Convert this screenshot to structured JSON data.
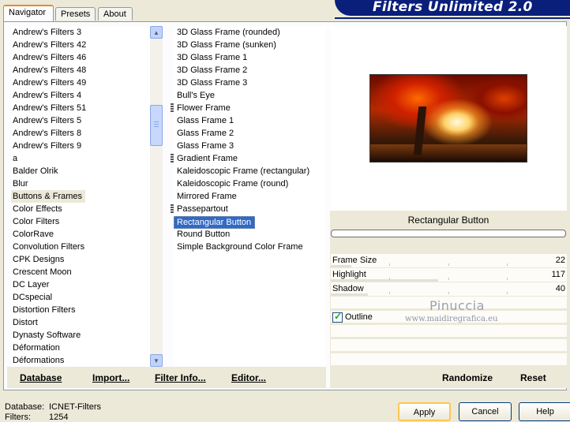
{
  "tabs": [
    "Navigator",
    "Presets",
    "About"
  ],
  "banner_title": "Filters Unlimited 2.0",
  "categories": [
    "Andrew's Filters 3",
    "Andrew's Filters 42",
    "Andrew's Filters 46",
    "Andrew's Filters 48",
    "Andrew's Filters 49",
    "Andrew's Filters 4",
    "Andrew's Filters 51",
    "Andrew's Filters 5",
    "Andrew's Filters 8",
    "Andrew's Filters 9",
    "a",
    "Balder Olrik",
    "Blur",
    "Buttons & Frames",
    "Color Effects",
    "Color Filters",
    "ColorRave",
    "Convolution Filters",
    "CPK Designs",
    "Crescent Moon",
    "DC Layer",
    "DCspecial",
    "Distortion Filters",
    "Distort",
    "Dynasty Software",
    "Déformation",
    "Déformations"
  ],
  "selected_category": "Buttons & Frames",
  "filters": [
    "3D Glass Frame (rounded)",
    "3D Glass Frame (sunken)",
    "3D Glass Frame 1",
    "3D Glass Frame 2",
    "3D Glass Frame 3",
    "Bull's Eye",
    "Flower Frame",
    "Glass Frame 1",
    "Glass Frame 2",
    "Glass Frame 3",
    "Gradient Frame",
    "Kaleidoscopic Frame (rectangular)",
    "Kaleidoscopic Frame (round)",
    "Mirrored Frame",
    "Passepartout",
    "Rectangular Button",
    "Round Button",
    "Simple Background Color Frame"
  ],
  "marked_filters": [
    "Flower Frame",
    "Gradient Frame",
    "Passepartout"
  ],
  "selected_filter": "Rectangular Button",
  "toolbar": {
    "database": "Database",
    "import": "Import...",
    "filter_info": "Filter Info...",
    "editor": "Editor..."
  },
  "filter_name": "Rectangular Button",
  "controls": [
    {
      "label": "Frame Size",
      "value": "22",
      "level": 22
    },
    {
      "label": "Highlight",
      "value": "117",
      "level": 117
    },
    {
      "label": "Shadow",
      "value": "40",
      "level": 40
    }
  ],
  "outline": {
    "label": "Outline",
    "checked": true
  },
  "watermark": {
    "name": "Pinuccia",
    "site": "www.maidiregrafica.eu"
  },
  "randomize": "Randomize",
  "reset": "Reset",
  "info": {
    "database_label": "Database:",
    "database_value": "ICNET-Filters",
    "filters_label": "Filters:",
    "filters_value": "1254"
  },
  "dialog": {
    "apply": "Apply",
    "cancel": "Cancel",
    "help": "Help"
  },
  "colors": {
    "selection": "#316ac5",
    "banner": "#0a1f7a",
    "accent_tab": "#e68b2c"
  }
}
